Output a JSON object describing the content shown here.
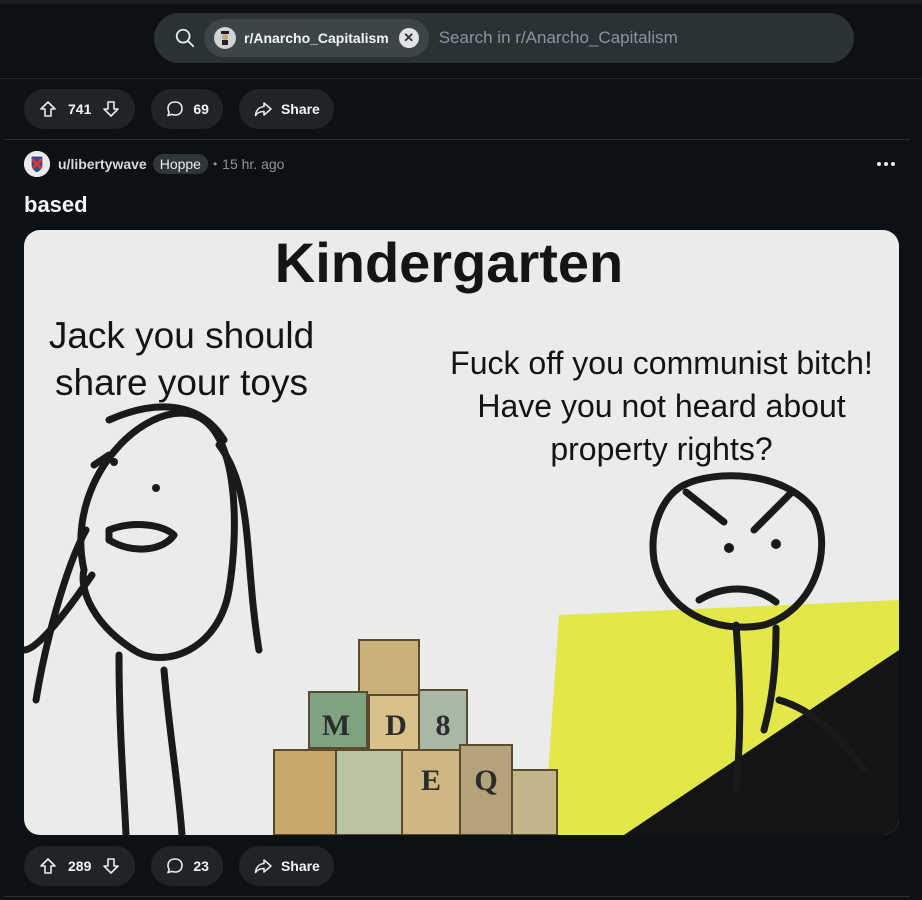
{
  "search": {
    "community_chip": "r/Anarcho_Capitalism",
    "placeholder": "Search in r/Anarcho_Capitalism"
  },
  "prev_post": {
    "upvotes": "741",
    "comments": "69",
    "share_label": "Share"
  },
  "post": {
    "username": "u/libertywave",
    "flair": "Hoppe",
    "separator": "•",
    "time": "15 hr. ago",
    "title": "based",
    "image": {
      "heading": "Kindergarten",
      "left_line1": "Jack you should",
      "left_line2": "share your toys",
      "right_line1": "Fuck off you communist bitch!",
      "right_line2": "Have you not heard about",
      "right_line3": "property rights?",
      "blocks": [
        "M",
        "D",
        "8",
        "E",
        "Q"
      ]
    },
    "upvotes": "289",
    "comments": "23",
    "share_label": "Share"
  },
  "colors": {
    "background": "#0e1113",
    "pill": "#1f2427",
    "search": "#2a3236",
    "meme_yellow": "#e2e84a"
  }
}
